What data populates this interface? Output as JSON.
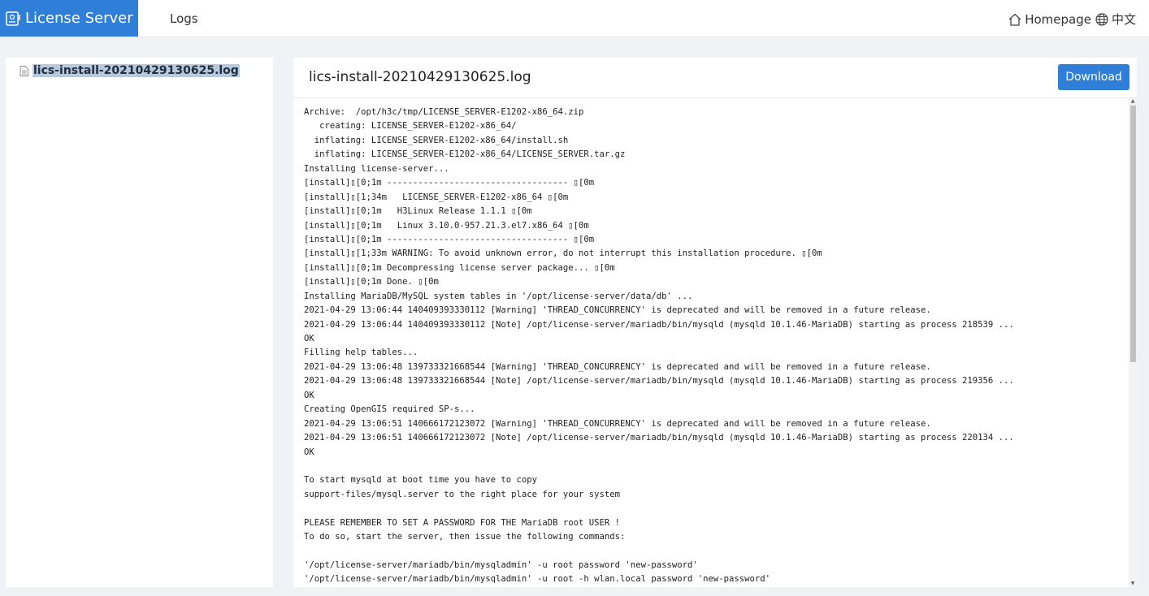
{
  "header": {
    "brand_label": "License Server",
    "brand_icon": "license-icon",
    "nav_logs": "Logs",
    "homepage_label": "Homepage",
    "homepage_icon": "home-icon",
    "language_label": "中文",
    "language_icon": "globe-icon",
    "accent_color": "#2f7fd8"
  },
  "sidebar": {
    "files": [
      {
        "name": "lics-install-20210429130625.log",
        "icon": "file-icon",
        "selected": true
      }
    ]
  },
  "main": {
    "title": "lics-install-20210429130625.log",
    "download_label": "Download",
    "log_lines": [
      "Archive:  /opt/h3c/tmp/LICENSE_SERVER-E1202-x86_64.zip",
      "   creating: LICENSE_SERVER-E1202-x86_64/",
      "  inflating: LICENSE_SERVER-E1202-x86_64/install.sh",
      "  inflating: LICENSE_SERVER-E1202-x86_64/LICENSE_SERVER.tar.gz",
      "Installing license-server...",
      "[install]\u001b[0;1m ----------------------------------- \u001b[0m",
      "[install]\u001b[1;34m   LICENSE_SERVER-E1202-x86_64 \u001b[0m",
      "[install]\u001b[0;1m   H3Linux Release 1.1.1 \u001b[0m",
      "[install]\u001b[0;1m   Linux 3.10.0-957.21.3.el7.x86_64 \u001b[0m",
      "[install]\u001b[0;1m ----------------------------------- \u001b[0m",
      "[install]\u001b[1;33m WARNING: To avoid unknown error, do not interrupt this installation procedure. \u001b[0m",
      "[install]\u001b[0;1m Decompressing license server package... \u001b[0m",
      "[install]\u001b[0;1m Done. \u001b[0m",
      "Installing MariaDB/MySQL system tables in '/opt/license-server/data/db' ...",
      "2021-04-29 13:06:44 140409393330112 [Warning] 'THREAD_CONCURRENCY' is deprecated and will be removed in a future release.",
      "2021-04-29 13:06:44 140409393330112 [Note] /opt/license-server/mariadb/bin/mysqld (mysqld 10.1.46-MariaDB) starting as process 218539 ...",
      "OK",
      "Filling help tables...",
      "2021-04-29 13:06:48 139733321668544 [Warning] 'THREAD_CONCURRENCY' is deprecated and will be removed in a future release.",
      "2021-04-29 13:06:48 139733321668544 [Note] /opt/license-server/mariadb/bin/mysqld (mysqld 10.1.46-MariaDB) starting as process 219356 ...",
      "OK",
      "Creating OpenGIS required SP-s...",
      "2021-04-29 13:06:51 140666172123072 [Warning] 'THREAD_CONCURRENCY' is deprecated and will be removed in a future release.",
      "2021-04-29 13:06:51 140666172123072 [Note] /opt/license-server/mariadb/bin/mysqld (mysqld 10.1.46-MariaDB) starting as process 220134 ...",
      "OK",
      "",
      "To start mysqld at boot time you have to copy",
      "support-files/mysql.server to the right place for your system",
      "",
      "PLEASE REMEMBER TO SET A PASSWORD FOR THE MariaDB root USER !",
      "To do so, start the server, then issue the following commands:",
      "",
      "'/opt/license-server/mariadb/bin/mysqladmin' -u root password 'new-password'",
      "'/opt/license-server/mariadb/bin/mysqladmin' -u root -h wlan.local password 'new-password'"
    ]
  }
}
